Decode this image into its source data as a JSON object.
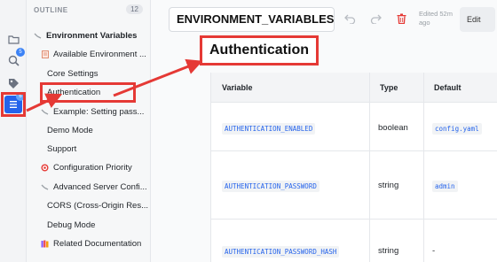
{
  "activity": {
    "icons": [
      "folder-icon",
      "search-icon",
      "tag-icon",
      "outline-icon"
    ],
    "search_badge": "5",
    "outline_badge": "6"
  },
  "outline": {
    "header": "OUTLINE",
    "count": "12",
    "items": [
      {
        "label": "Environment Variables",
        "icon": "link-icon"
      },
      {
        "label": "Available Environment ...",
        "icon": "document-icon"
      },
      {
        "label": "Core Settings",
        "icon": ""
      },
      {
        "label": "Authentication",
        "icon": ""
      },
      {
        "label": "Example: Setting pass...",
        "icon": "link-icon"
      },
      {
        "label": "Demo Mode",
        "icon": ""
      },
      {
        "label": "Support",
        "icon": ""
      },
      {
        "label": "Configuration Priority",
        "icon": "target-icon"
      },
      {
        "label": "Advanced Server Confi...",
        "icon": "link-icon"
      },
      {
        "label": "CORS (Cross-Origin Res...",
        "icon": ""
      },
      {
        "label": "Debug Mode",
        "icon": ""
      },
      {
        "label": "Related Documentation",
        "icon": "books-icon"
      }
    ]
  },
  "toolbar": {
    "page_title": "ENVIRONMENT_VARIABLES",
    "edited": "Edited 52m ago",
    "edit_label": "Edit"
  },
  "content": {
    "heading": "Authentication",
    "table": {
      "headers": [
        "Variable",
        "Type",
        "Default"
      ],
      "rows": [
        {
          "variable": "AUTHENTICATION_ENABLED",
          "type": "boolean",
          "default": "config.yaml"
        },
        {
          "variable": "AUTHENTICATION_PASSWORD",
          "type": "string",
          "default": "admin"
        },
        {
          "variable": "AUTHENTICATION_PASSWORD_HASH",
          "type": "string",
          "default": "-"
        }
      ]
    }
  },
  "colors": {
    "annotation": "#e53935",
    "accent": "#2563eb",
    "code_text": "#2563eb"
  }
}
